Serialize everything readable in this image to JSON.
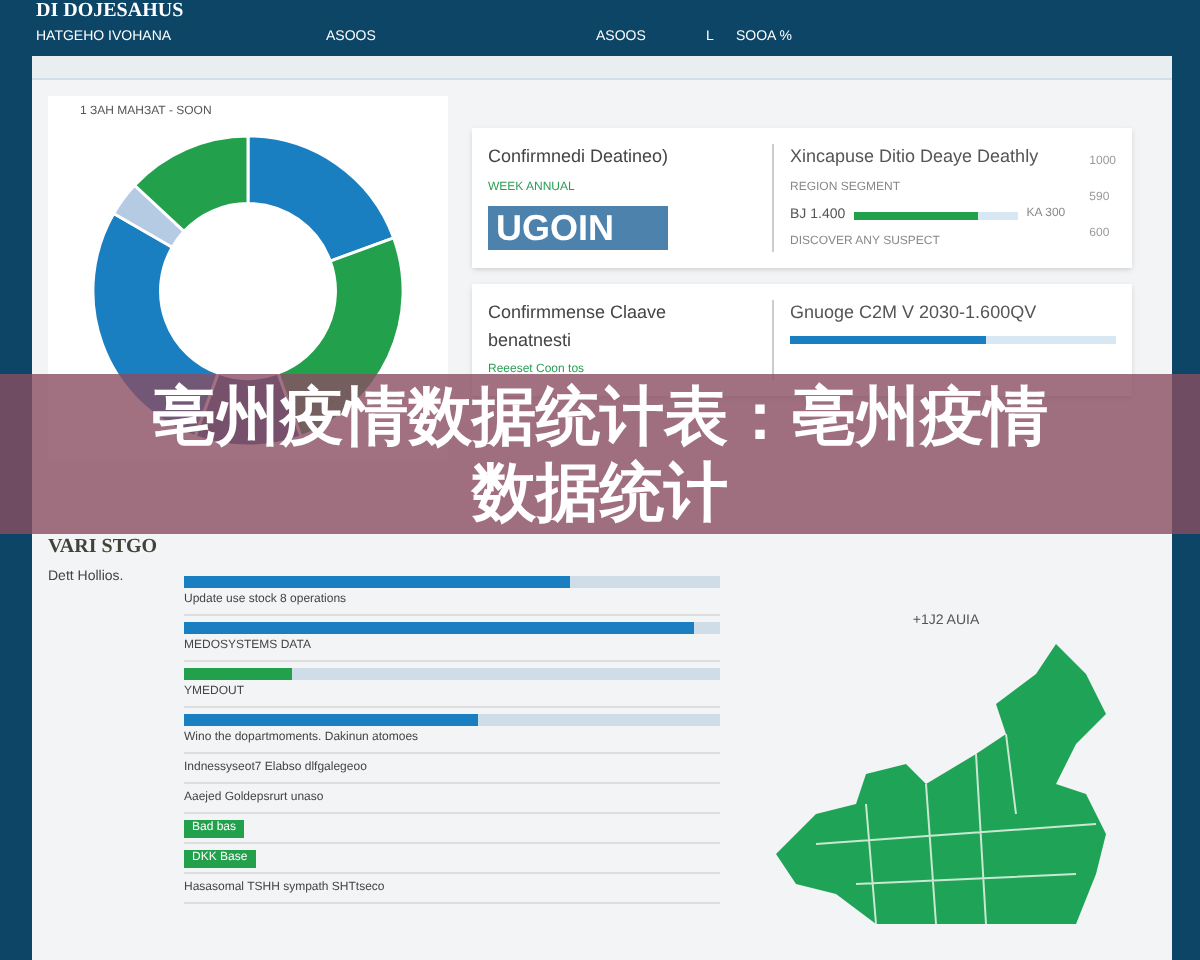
{
  "header": {
    "title": "DI DOJESAHUS",
    "labels": [
      "HATGEHO IVOHANA",
      "ASOOS",
      "ASOOS",
      "L",
      "SOOA %"
    ]
  },
  "donut_panel": {
    "caption": "1 ЗАН МАНЗАТ - SOON"
  },
  "cards": [
    {
      "title": "Confirmnedi Deatineo)",
      "subtitle": "WEEK ANNUAL",
      "big_number": "UGOIN",
      "right_title": "Xincapuse  Ditio Deaye  Deathly",
      "right_caption": "REGION SEGMENT",
      "value": "BJ 1.400",
      "level": 0.75,
      "bar_reading": "KA 300",
      "foot": "DISCOVER ANY SUSPECT",
      "ticks": [
        "1000",
        "590",
        "600"
      ]
    },
    {
      "title": "Confirmmense Claave  benatnesti",
      "subtitle": "Reeeset Coon tos",
      "right_title": "Gnuoge  C2M V  2030-1.600QV",
      "level": 0.6
    }
  ],
  "banner": {
    "text": "亳州疫情数据统计表：亳州疫情数据统计"
  },
  "list_panel": {
    "heading": "VARI STGO",
    "label": "Dett Hollios.",
    "rows": [
      {
        "kind": "bar",
        "text": "Update use stock 8 operations",
        "level": 0.72,
        "color": "#1a7fc1"
      },
      {
        "kind": "bar",
        "text": "MEDOSYSTEMS DATA",
        "level": 0.95,
        "color": "#1a7fc1"
      },
      {
        "kind": "bar",
        "text": "YMEDOUT",
        "level": 0.2,
        "color": "#22a04b"
      },
      {
        "kind": "bar",
        "text": "Wino the dopartmoments. Dakinun atomoes",
        "level": 0.55,
        "color": "#1a7fc1"
      },
      {
        "kind": "text",
        "text": "Indnessyseot7 Elabso dlfgalegeoo"
      },
      {
        "kind": "text",
        "text": "Aaejed Goldepsrurt unaso"
      },
      {
        "kind": "tag",
        "text": "Bad bas"
      },
      {
        "kind": "tag",
        "text": "DKK Base"
      },
      {
        "kind": "text",
        "text": "Hasasomal TSHH sympath SHTtseco"
      }
    ]
  },
  "map_panel": {
    "label": "+1J2 AUIA"
  }
}
